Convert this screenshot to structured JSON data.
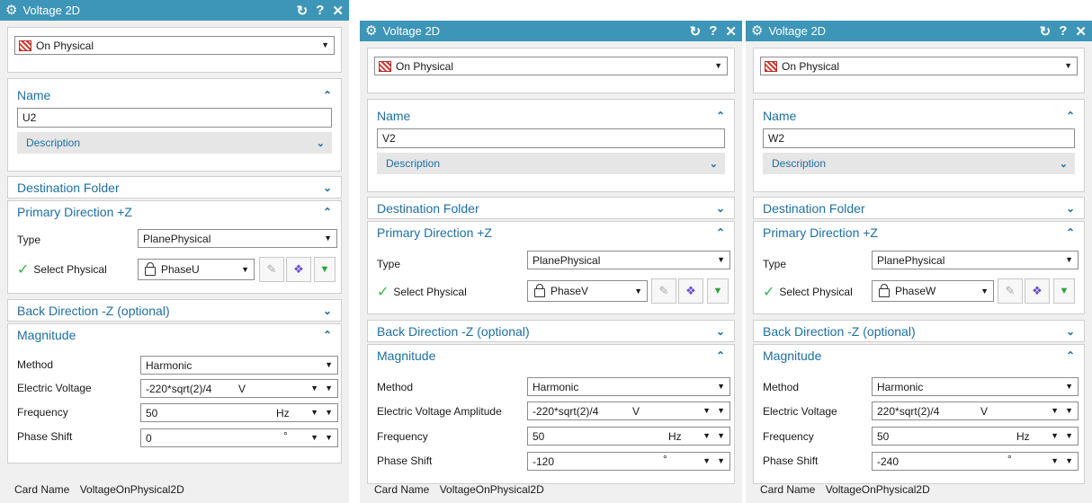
{
  "common": {
    "title": "Voltage 2D",
    "reset_glyph": "↻",
    "help_glyph": "?",
    "close_glyph": "✕",
    "on_physical": "On Physical",
    "name_label": "Name",
    "description_label": "Description",
    "destination_label": "Destination Folder",
    "primary_label": "Primary Direction +Z",
    "type_label": "Type",
    "type_value": "PlanePhysical",
    "select_label": "Select Physical",
    "back_label": "Back Direction -Z (optional)",
    "magnitude_label": "Magnitude",
    "method_label": "Method",
    "method_value": "Harmonic",
    "frequency_label": "Frequency",
    "frequency_value": "50",
    "frequency_unit": "Hz",
    "phase_label": "Phase Shift",
    "voltage_unit": "V",
    "phase_unit": "°",
    "card_label": "Card Name",
    "card_value": "VoltageOnPhysical2D"
  },
  "dialogs": [
    {
      "name": "U2",
      "physical": "PhaseU",
      "voltage_label": "Electric Voltage",
      "voltage_value": "-220*sqrt(2)/4",
      "phase_value": "0"
    },
    {
      "name": "V2",
      "physical": "PhaseV",
      "voltage_label": "Electric Voltage Amplitude",
      "voltage_value": "-220*sqrt(2)/4",
      "phase_value": "-120"
    },
    {
      "name": "W2",
      "physical": "PhaseW",
      "voltage_label": "Electric Voltage",
      "voltage_value": "220*sqrt(2)/4",
      "phase_value": "-240"
    }
  ]
}
